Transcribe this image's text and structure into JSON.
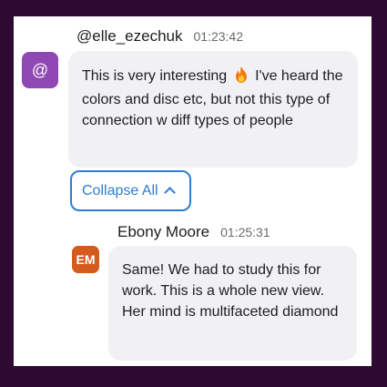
{
  "messages": [
    {
      "username": "@elle_ezechuk",
      "timestamp": "01:23:42",
      "avatar_text": "@",
      "avatar_color": "#8f47b3",
      "text_before_emoji": "This is very interesting",
      "emoji": "fire-emoji",
      "text_after_emoji": "I've heard the colors and disc etc, but not this type of connection w diff types of people"
    },
    {
      "username": "Ebony Moore",
      "timestamp": "01:25:31",
      "avatar_text": "EM",
      "avatar_color": "#d45a1e",
      "text": "Same! We had to study this for work. This is a whole new view. Her mind is multifaceted diamond"
    }
  ],
  "collapse_button": {
    "label": "Collapse All",
    "icon": "chevron-up-icon"
  },
  "colors": {
    "frame_background": "#2e0a33",
    "bubble_background": "#f1f1f4",
    "accent": "#2d7dd2"
  }
}
